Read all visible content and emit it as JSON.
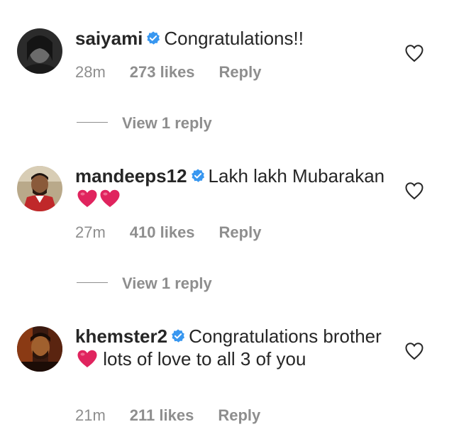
{
  "colors": {
    "text": "#262626",
    "secondary": "#8e8e8e",
    "verified": "#3897f0",
    "heart": "#e0245e"
  },
  "comments": [
    {
      "username": "saiyami",
      "verified": true,
      "text_parts": [
        "Congratulations!!"
      ],
      "time": "28m",
      "likes": "273 likes",
      "reply": "Reply",
      "view_replies": "View 1 reply"
    },
    {
      "username": "mandeeps12",
      "verified": true,
      "text_parts": [
        "Lakh lakh Mubarakan"
      ],
      "emoji": [
        "red-heart",
        "red-heart"
      ],
      "time": "27m",
      "likes": "410 likes",
      "reply": "Reply",
      "view_replies": "View 1 reply"
    },
    {
      "username": "khemster2",
      "verified": true,
      "text_parts": [
        "Congratulations brother",
        "lots of love to all 3 of you"
      ],
      "emoji": [
        "red-heart"
      ],
      "time": "21m",
      "likes": "211 likes",
      "reply": "Reply"
    }
  ]
}
